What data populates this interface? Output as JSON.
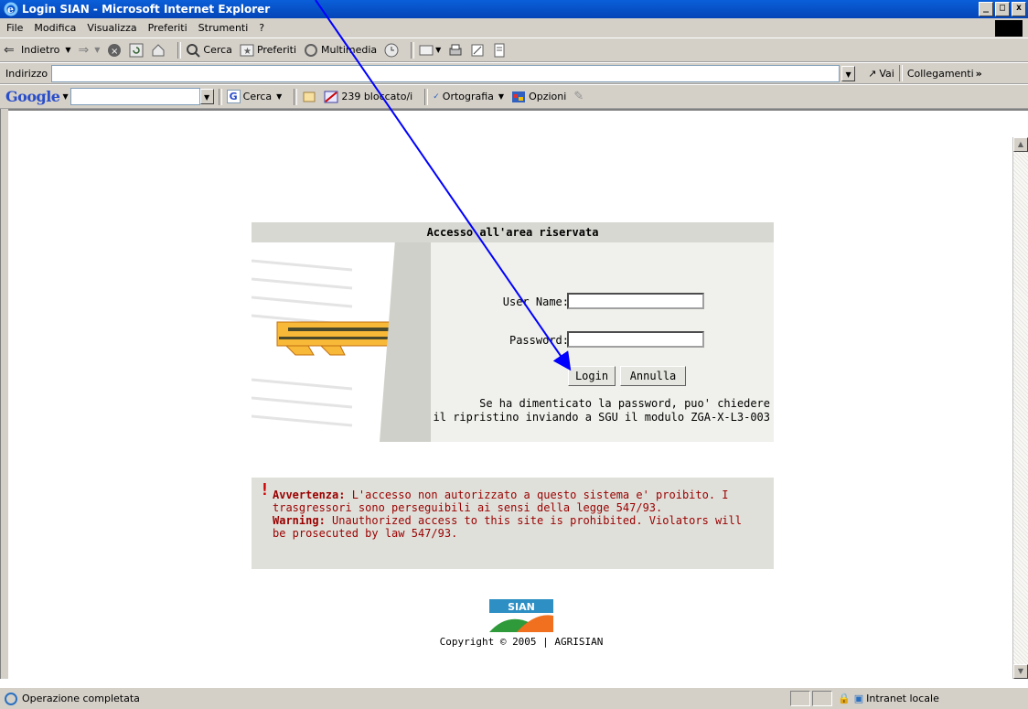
{
  "window": {
    "title": "Login SIAN - Microsoft Internet Explorer",
    "min": "_",
    "max": "□",
    "close": "x"
  },
  "menu": [
    "File",
    "Modifica",
    "Visualizza",
    "Preferiti",
    "Strumenti",
    "?"
  ],
  "toolbar": {
    "back": "Indietro",
    "search": "Cerca",
    "favorites": "Preferiti",
    "media": "Multimedia"
  },
  "address": {
    "label": "Indirizzo",
    "value": "",
    "go": "Vai",
    "links": "Collegamenti"
  },
  "google": {
    "logo": "Google",
    "search": "Cerca",
    "blocked": "239 bloccato/i",
    "spelling": "Ortografia",
    "options": "Opzioni"
  },
  "login": {
    "header": "Accesso all'area riservata",
    "username_label": "User Name:",
    "password_label": "Password:",
    "username_value": "",
    "password_value": "",
    "login_button": "Login",
    "cancel_button": "Annulla",
    "note_line1": "Se ha dimenticato la password, puo' chiedere",
    "note_line2": "il ripristino inviando a SGU il modulo ZGA-X-L3-003"
  },
  "warning": {
    "it_title": "Avvertenza:",
    "it_text": " L'accesso non autorizzato a questo sistema e' proibito. I trasgressori sono perseguibili ai sensi della legge 547/93.",
    "en_title": "Warning:",
    "en_text": " Unauthorized access to this site is prohibited. Violators will be prosecuted by law 547/93."
  },
  "footer": {
    "logo_text": "SIAN",
    "copyright": "Copyright © 2005 | AGRISIAN"
  },
  "status": {
    "text": "Operazione completata",
    "zone": "Intranet locale"
  },
  "colors": {
    "titlebar": "#0a5fd8",
    "warning_text": "#990000",
    "key": "#f8b838",
    "annotation_arrow": "#0000ff"
  }
}
